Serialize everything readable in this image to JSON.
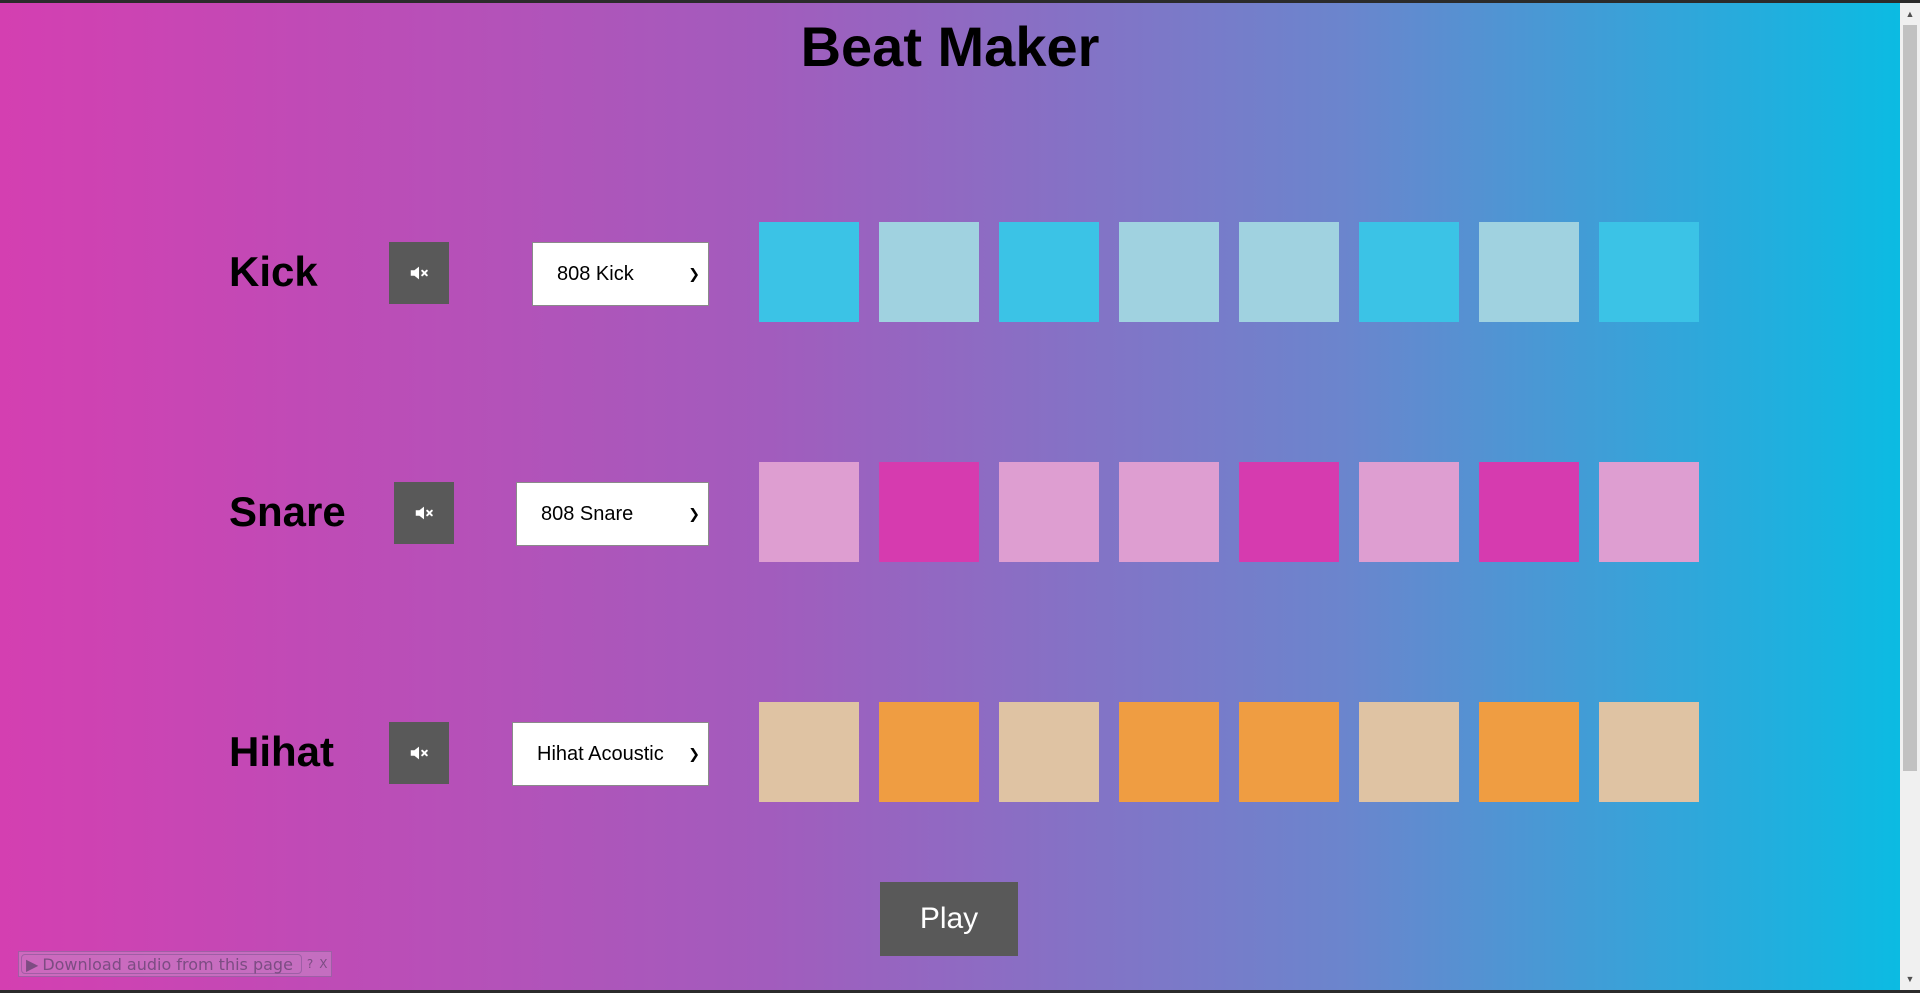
{
  "title": "Beat Maker",
  "colors": {
    "kick_on": "#3bc3e6",
    "kick_off": "#a0d2e0",
    "snare_on": "#d63baf",
    "snare_off": "#de9ed1",
    "hihat_on": "#ef9d42",
    "hihat_off": "#dfc3a3",
    "button_bg": "#595959"
  },
  "tracks": [
    {
      "name": "Kick",
      "mute_icon": "volume-mute-icon",
      "selected_sound": "808 Kick",
      "pads": [
        true,
        false,
        true,
        false,
        false,
        true,
        false,
        true
      ]
    },
    {
      "name": "Snare",
      "mute_icon": "volume-mute-icon",
      "selected_sound": "808 Snare",
      "pads": [
        false,
        true,
        false,
        false,
        true,
        false,
        true,
        false
      ]
    },
    {
      "name": "Hihat",
      "mute_icon": "volume-mute-icon",
      "selected_sound": "Hihat Acoustic",
      "pads": [
        false,
        true,
        false,
        true,
        true,
        false,
        true,
        false
      ]
    }
  ],
  "play_label": "Play",
  "download_bar": {
    "label": "Download audio from this page",
    "help": "?",
    "close": "X"
  }
}
